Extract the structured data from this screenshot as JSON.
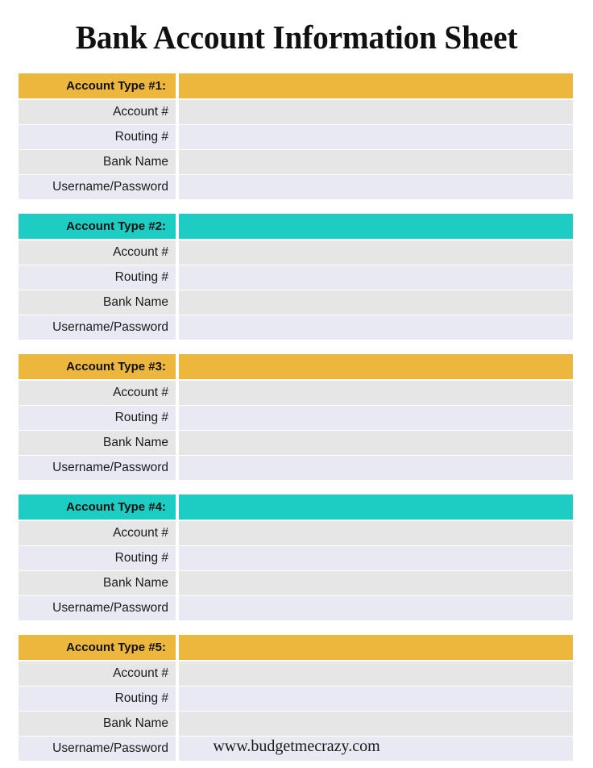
{
  "document": {
    "title": "Bank Account Information Sheet",
    "footer_url": "www.budgetmecrazy.com"
  },
  "colors": {
    "accent_yellow": "#EDB73E",
    "accent_teal": "#1DCDC3",
    "row_gray": "#E6E6E6",
    "row_lavender": "#E8E9F3",
    "page_background": "#FFFFFF",
    "text": "#111111"
  },
  "field_labels": {
    "account_number": "Account #",
    "routing_number": "Routing #",
    "bank_name": "Bank Name",
    "username_password": "Username/Password"
  },
  "blocks": [
    {
      "header_label": "Account Type #1:",
      "header_value": "",
      "accent": "yellow",
      "rows": [
        {
          "label": "Account #",
          "value": ""
        },
        {
          "label": "Routing #",
          "value": ""
        },
        {
          "label": "Bank Name",
          "value": ""
        },
        {
          "label": "Username/Password",
          "value": ""
        }
      ]
    },
    {
      "header_label": "Account Type #2:",
      "header_value": "",
      "accent": "teal",
      "rows": [
        {
          "label": "Account #",
          "value": ""
        },
        {
          "label": "Routing #",
          "value": ""
        },
        {
          "label": "Bank Name",
          "value": ""
        },
        {
          "label": "Username/Password",
          "value": ""
        }
      ]
    },
    {
      "header_label": "Account Type #3:",
      "header_value": "",
      "accent": "yellow",
      "rows": [
        {
          "label": "Account #",
          "value": ""
        },
        {
          "label": "Routing #",
          "value": ""
        },
        {
          "label": "Bank Name",
          "value": ""
        },
        {
          "label": "Username/Password",
          "value": ""
        }
      ]
    },
    {
      "header_label": "Account Type #4:",
      "header_value": "",
      "accent": "teal",
      "rows": [
        {
          "label": "Account #",
          "value": ""
        },
        {
          "label": "Routing #",
          "value": ""
        },
        {
          "label": "Bank Name",
          "value": ""
        },
        {
          "label": "Username/Password",
          "value": ""
        }
      ]
    },
    {
      "header_label": "Account Type #5:",
      "header_value": "",
      "accent": "yellow",
      "rows": [
        {
          "label": "Account #",
          "value": ""
        },
        {
          "label": "Routing #",
          "value": ""
        },
        {
          "label": "Bank Name",
          "value": ""
        },
        {
          "label": "Username/Password",
          "value": ""
        }
      ]
    }
  ]
}
